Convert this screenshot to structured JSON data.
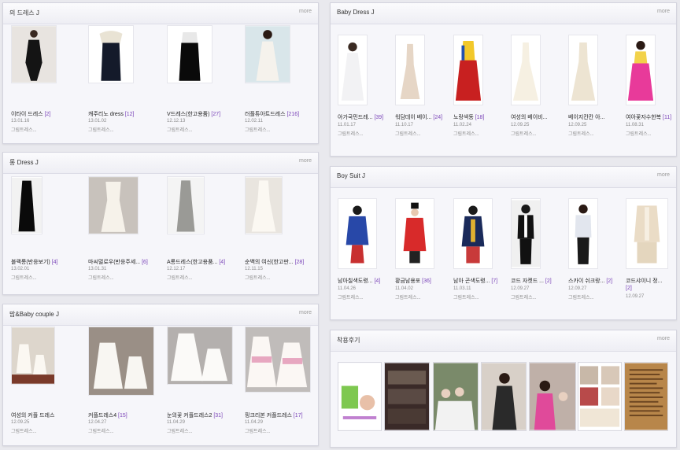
{
  "panels": {
    "p1": {
      "title": "의 드레스 J",
      "more": "more",
      "items": [
        {
          "title": "이타이 드레스",
          "count": "[2]",
          "date": "13.01.16",
          "sub": "그림트레스..."
        },
        {
          "title": "캐주리노 dress",
          "count": "[12]",
          "date": "13.01.02",
          "sub": "그림트레스..."
        },
        {
          "title": "V드레스(한고용품)",
          "count": "[27]",
          "date": "12.12.13",
          "sub": "그림트레스..."
        },
        {
          "title": "러플튜아트드레스",
          "count": "[216]",
          "date": "12.02.11",
          "sub": "그림트레스..."
        }
      ]
    },
    "p2": {
      "title": "롱 Dress J",
      "more": "more",
      "items": [
        {
          "title": "블랙롱(반응보기)",
          "count": "[4]",
          "date": "13.02.01",
          "sub": "그림트레스..."
        },
        {
          "title": "마씨멀로우(반응주세...",
          "count": "[6]",
          "date": "13.01.31",
          "sub": "그림트레스..."
        },
        {
          "title": "A롱드레스(한고용품...",
          "count": "[4]",
          "date": "12.12.17",
          "sub": "그림트레스..."
        },
        {
          "title": "순백의 여신(한고판...",
          "count": "[28]",
          "date": "12.11.15",
          "sub": "그림트레스..."
        }
      ]
    },
    "p3": {
      "title": "맘&Baby couple J",
      "more": "more",
      "items": [
        {
          "title": "여성의 커플 드레스",
          "count": "",
          "date": "12.09.25",
          "sub": "그림트레스..."
        },
        {
          "title": "커플드레스4",
          "count": "[15]",
          "date": "12.04.27",
          "sub": "그림트레스..."
        },
        {
          "title": "눈의꽃 커플드레스2",
          "count": "[31]",
          "date": "11.04.29",
          "sub": "그림트레스..."
        },
        {
          "title": "핑크리본 커플드레스",
          "count": "[17]",
          "date": "11.04.29",
          "sub": "그림트레스..."
        }
      ]
    },
    "p4": {
      "title": "Baby Dress J",
      "more": "more",
      "items": [
        {
          "title": "아가국민드레...",
          "count": "[39]",
          "date": "11.01.17",
          "sub": "그림트레스..."
        },
        {
          "title": "워담데이 베이...",
          "count": "[24]",
          "date": "11.10.17",
          "sub": "그림트레스..."
        },
        {
          "title": "노랑색동",
          "count": "[18]",
          "date": "11.02.24",
          "sub": "그림트레스..."
        },
        {
          "title": "여성의 베이비...",
          "count": "",
          "date": "12.09.25",
          "sub": "그림트레스..."
        },
        {
          "title": "베이지칸칸 아...",
          "count": "",
          "date": "12.09.25",
          "sub": "그림트레스..."
        },
        {
          "title": "여아꽃자수한복",
          "count": "[11]",
          "date": "11.08.31",
          "sub": "그림트레스..."
        }
      ]
    },
    "p5": {
      "title": "Boy Suit J",
      "more": "more",
      "items": [
        {
          "title": "남아칠색도령...",
          "count": "[4]",
          "date": "11.04.26",
          "sub": "그림트레스..."
        },
        {
          "title": "황금남용포",
          "count": "[36]",
          "date": "11.04.02",
          "sub": "그림트레스..."
        },
        {
          "title": "남아 곤색도령...",
          "count": "[7]",
          "date": "11.03.11",
          "sub": "그림트레스..."
        },
        {
          "title": "코드 자켓드 ...",
          "count": "[2]",
          "date": "12.09.27",
          "sub": "그림트레스..."
        },
        {
          "title": "스카이 쉬크랑...",
          "count": "[2]",
          "date": "12.09.27",
          "sub": "그림트레스..."
        },
        {
          "title": "코드샤이니 정...",
          "count": "[2]",
          "date": "12.09.27",
          "sub": ""
        }
      ]
    },
    "p6": {
      "title": "착용후기",
      "more": "more"
    }
  }
}
